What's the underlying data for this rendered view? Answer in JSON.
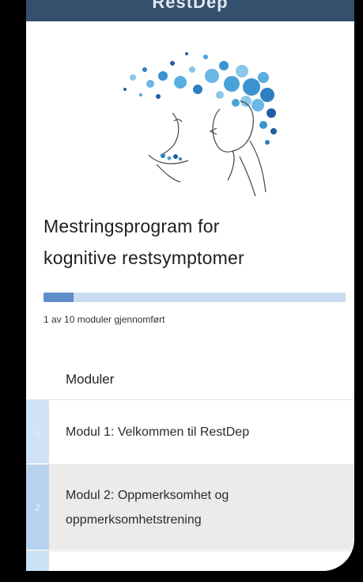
{
  "app": {
    "name": "RestDep"
  },
  "program": {
    "title_line1": "Mestringsprogram for",
    "title_line2": "kognitive restsymptomer",
    "progress_fraction": 0.1,
    "progress_text": "1 av 10 moduler gjennomført"
  },
  "modules": {
    "heading": "Moduler",
    "items": [
      {
        "number": "1",
        "label": "Modul 1: Velkommen til RestDep"
      },
      {
        "number": "2",
        "label_line1": "Modul 2: Oppmerksomhet og",
        "label_line2": "oppmerksomhetstrening"
      }
    ]
  },
  "colors": {
    "topbar": "#35506c",
    "progress_fill": "#5f8fc9",
    "progress_track": "#c9dcf2",
    "module_index_bar": "#b9d4ef",
    "module_active_bg": "#ecebe9"
  }
}
